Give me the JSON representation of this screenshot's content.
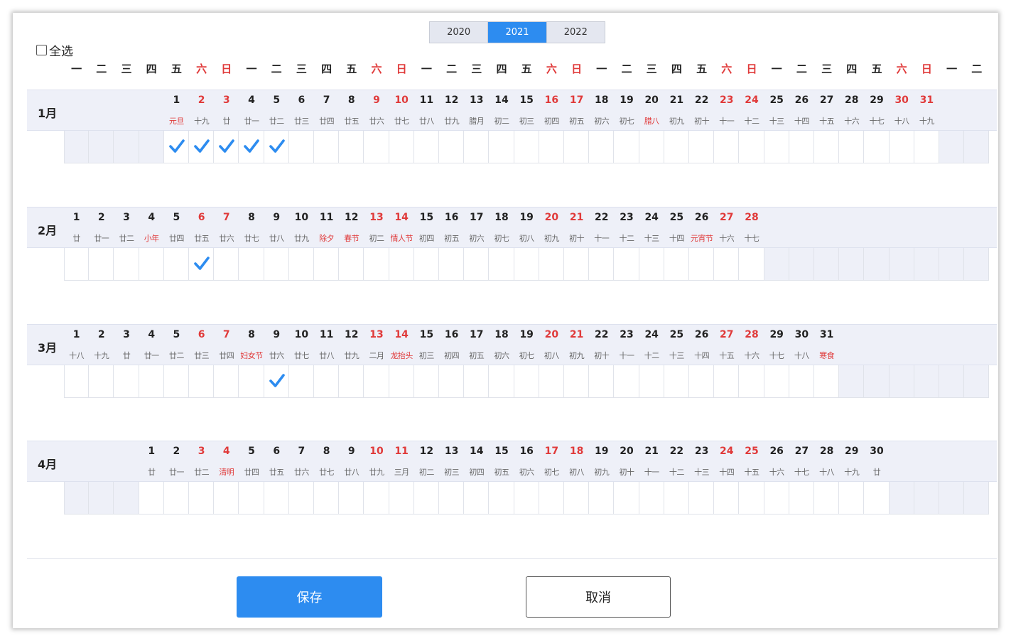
{
  "years": [
    "2020",
    "2021",
    "2022"
  ],
  "active_year": "2021",
  "select_all_label": "全选",
  "weekday_header": [
    "一",
    "二",
    "三",
    "四",
    "五",
    "六",
    "日",
    "一",
    "二",
    "三",
    "四",
    "五",
    "六",
    "日",
    "一",
    "二",
    "三",
    "四",
    "五",
    "六",
    "日",
    "一",
    "二",
    "三",
    "四",
    "五",
    "六",
    "日",
    "一",
    "二",
    "三",
    "四",
    "五",
    "六",
    "日",
    "一",
    "二"
  ],
  "months": [
    {
      "label": "1月",
      "offset": 4,
      "days": 31,
      "red_days": [
        2,
        3,
        9,
        10,
        16,
        17,
        23,
        24,
        30,
        31
      ],
      "lunar": [
        "元旦",
        "十九",
        "廿",
        "廿一",
        "廿二",
        "廿三",
        "廿四",
        "廿五",
        "廿六",
        "廿七",
        "廿八",
        "廿九",
        "腊月",
        "初二",
        "初三",
        "初四",
        "初五",
        "初六",
        "初七",
        "腊八",
        "初九",
        "初十",
        "十一",
        "十二",
        "十三",
        "十四",
        "十五",
        "十六",
        "十七",
        "十八",
        "十九"
      ],
      "red_lunar": [
        1,
        20
      ],
      "checked": [
        1,
        2,
        3,
        4,
        5
      ]
    },
    {
      "label": "2月",
      "offset": 0,
      "days": 28,
      "red_days": [
        6,
        7,
        13,
        14,
        20,
        21,
        27,
        28
      ],
      "lunar": [
        "廿",
        "廿一",
        "廿二",
        "小年",
        "廿四",
        "廿五",
        "廿六",
        "廿七",
        "廿八",
        "廿九",
        "除夕",
        "春节",
        "初二",
        "情人节",
        "初四",
        "初五",
        "初六",
        "初七",
        "初八",
        "初九",
        "初十",
        "十一",
        "十二",
        "十三",
        "十四",
        "元宵节",
        "十六",
        "十七"
      ],
      "red_lunar": [
        4,
        11,
        12,
        14,
        26
      ],
      "checked": [
        6
      ]
    },
    {
      "label": "3月",
      "offset": 0,
      "days": 31,
      "red_days": [
        6,
        7,
        13,
        14,
        20,
        21,
        27,
        28
      ],
      "lunar": [
        "十八",
        "十九",
        "廿",
        "廿一",
        "廿二",
        "廿三",
        "廿四",
        "妇女节",
        "廿六",
        "廿七",
        "廿八",
        "廿九",
        "二月",
        "龙抬头",
        "初三",
        "初四",
        "初五",
        "初六",
        "初七",
        "初八",
        "初九",
        "初十",
        "十一",
        "十二",
        "十三",
        "十四",
        "十五",
        "十六",
        "十七",
        "十八",
        "寒食"
      ],
      "red_lunar": [
        8,
        14,
        31
      ],
      "checked": [
        9
      ]
    },
    {
      "label": "4月",
      "offset": 3,
      "days": 30,
      "red_days": [
        3,
        4,
        10,
        11,
        17,
        18,
        24,
        25
      ],
      "lunar": [
        "廿",
        "廿一",
        "廿二",
        "清明",
        "廿四",
        "廿五",
        "廿六",
        "廿七",
        "廿八",
        "廿九",
        "三月",
        "初二",
        "初三",
        "初四",
        "初五",
        "初六",
        "初七",
        "初八",
        "初九",
        "初十",
        "十一",
        "十二",
        "十三",
        "十四",
        "十五",
        "十六",
        "十七",
        "十八",
        "十九",
        "廿"
      ],
      "red_lunar": [
        4
      ],
      "checked": []
    }
  ],
  "save_label": "保存",
  "cancel_label": "取消",
  "colors": {
    "accent": "#2d8cf0",
    "weekend": "#e03a3a",
    "header_bg": "#eef0f8"
  }
}
